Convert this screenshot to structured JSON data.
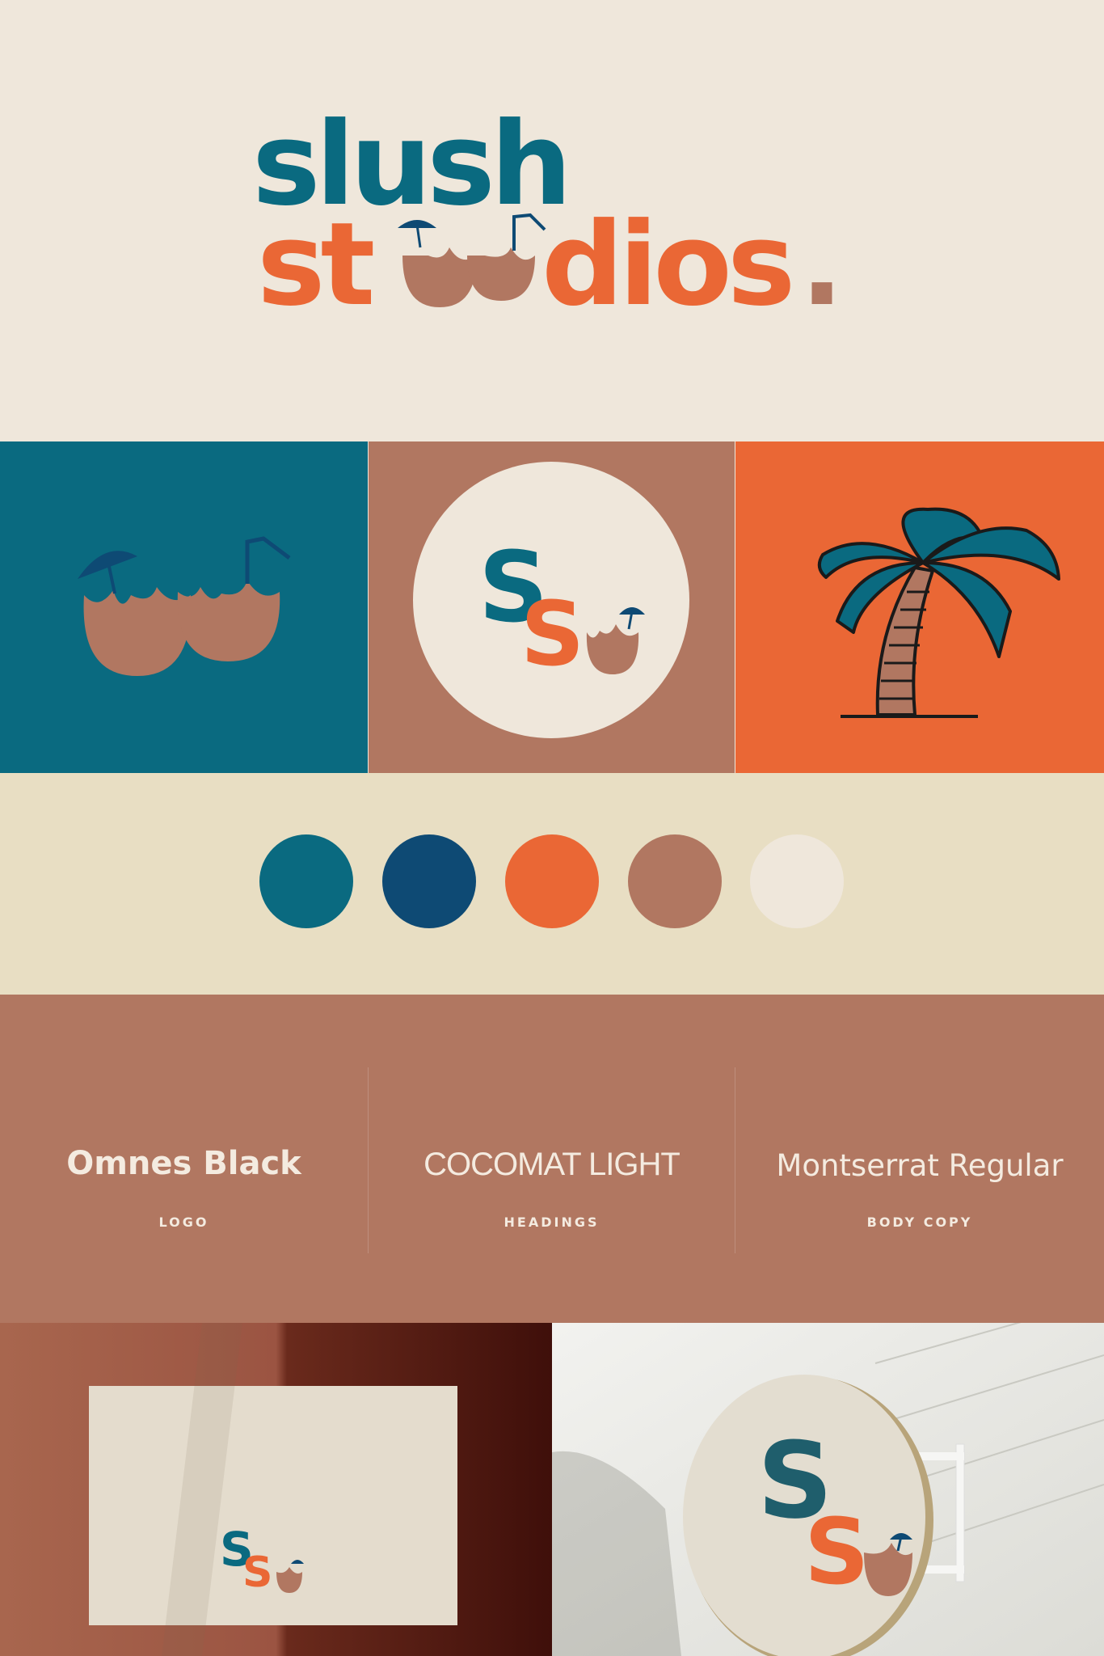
{
  "brand": {
    "line1": "slush",
    "line2_start": "st",
    "line2_end": "dios",
    "line2_period": "."
  },
  "colors": {
    "teal": "#0a6a80",
    "navy": "#0e4a74",
    "orange": "#ea6735",
    "clay": "#b17761",
    "cream": "#efe7db",
    "sand": "#e8dec3",
    "ink": "#1a1a1a"
  },
  "tiles": [
    {
      "name": "coconut-drinks-tile",
      "background": "#0a6a80",
      "icon": "coconut-drinks-icon"
    },
    {
      "name": "monogram-badge-tile",
      "background": "#b17761",
      "icon": "ss-monogram-icon"
    },
    {
      "name": "palm-tree-tile",
      "background": "#ea6735",
      "icon": "palm-tree-icon"
    }
  ],
  "palette": [
    {
      "name": "teal",
      "hex": "#0a6a80"
    },
    {
      "name": "navy",
      "hex": "#0e4a74"
    },
    {
      "name": "orange",
      "hex": "#ea6735"
    },
    {
      "name": "clay",
      "hex": "#b17761"
    },
    {
      "name": "cream",
      "hex": "#efe7db"
    }
  ],
  "typography": [
    {
      "font": "Omnes Black",
      "role": "LOGO"
    },
    {
      "font": "COCOMAT LIGHT",
      "role": "HEADINGS"
    },
    {
      "font": "Montserrat Regular",
      "role": "BODY COPY"
    }
  ],
  "mockups": [
    {
      "name": "business-card-mockup",
      "monogram": "SS"
    },
    {
      "name": "hanging-sign-mockup",
      "monogram": "SS"
    }
  ]
}
